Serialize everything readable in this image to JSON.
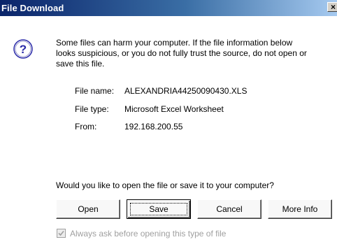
{
  "window": {
    "title": "File Download",
    "close_glyph": "×"
  },
  "icon": {
    "name": "question-icon",
    "glyph": "?",
    "color": "#2a2aa8"
  },
  "message": {
    "line1": "Some files can harm your computer. If the file information below",
    "line2": "looks suspicious, or you do not fully trust the source, do not open or",
    "line3": "save this file."
  },
  "file": {
    "name_label": "File name:",
    "name_value": "ALEXANDRIA44250090430.XLS",
    "type_label": "File type:",
    "type_value": "Microsoft Excel Worksheet",
    "from_label": "From:",
    "from_value": "192.168.200.55"
  },
  "question": "Would you like to open the file or save it to your computer?",
  "buttons": {
    "open": "Open",
    "save": "Save",
    "cancel": "Cancel",
    "more_info": "More Info"
  },
  "checkbox": {
    "label": "Always ask before opening this type of file",
    "checked": true,
    "disabled": true
  }
}
